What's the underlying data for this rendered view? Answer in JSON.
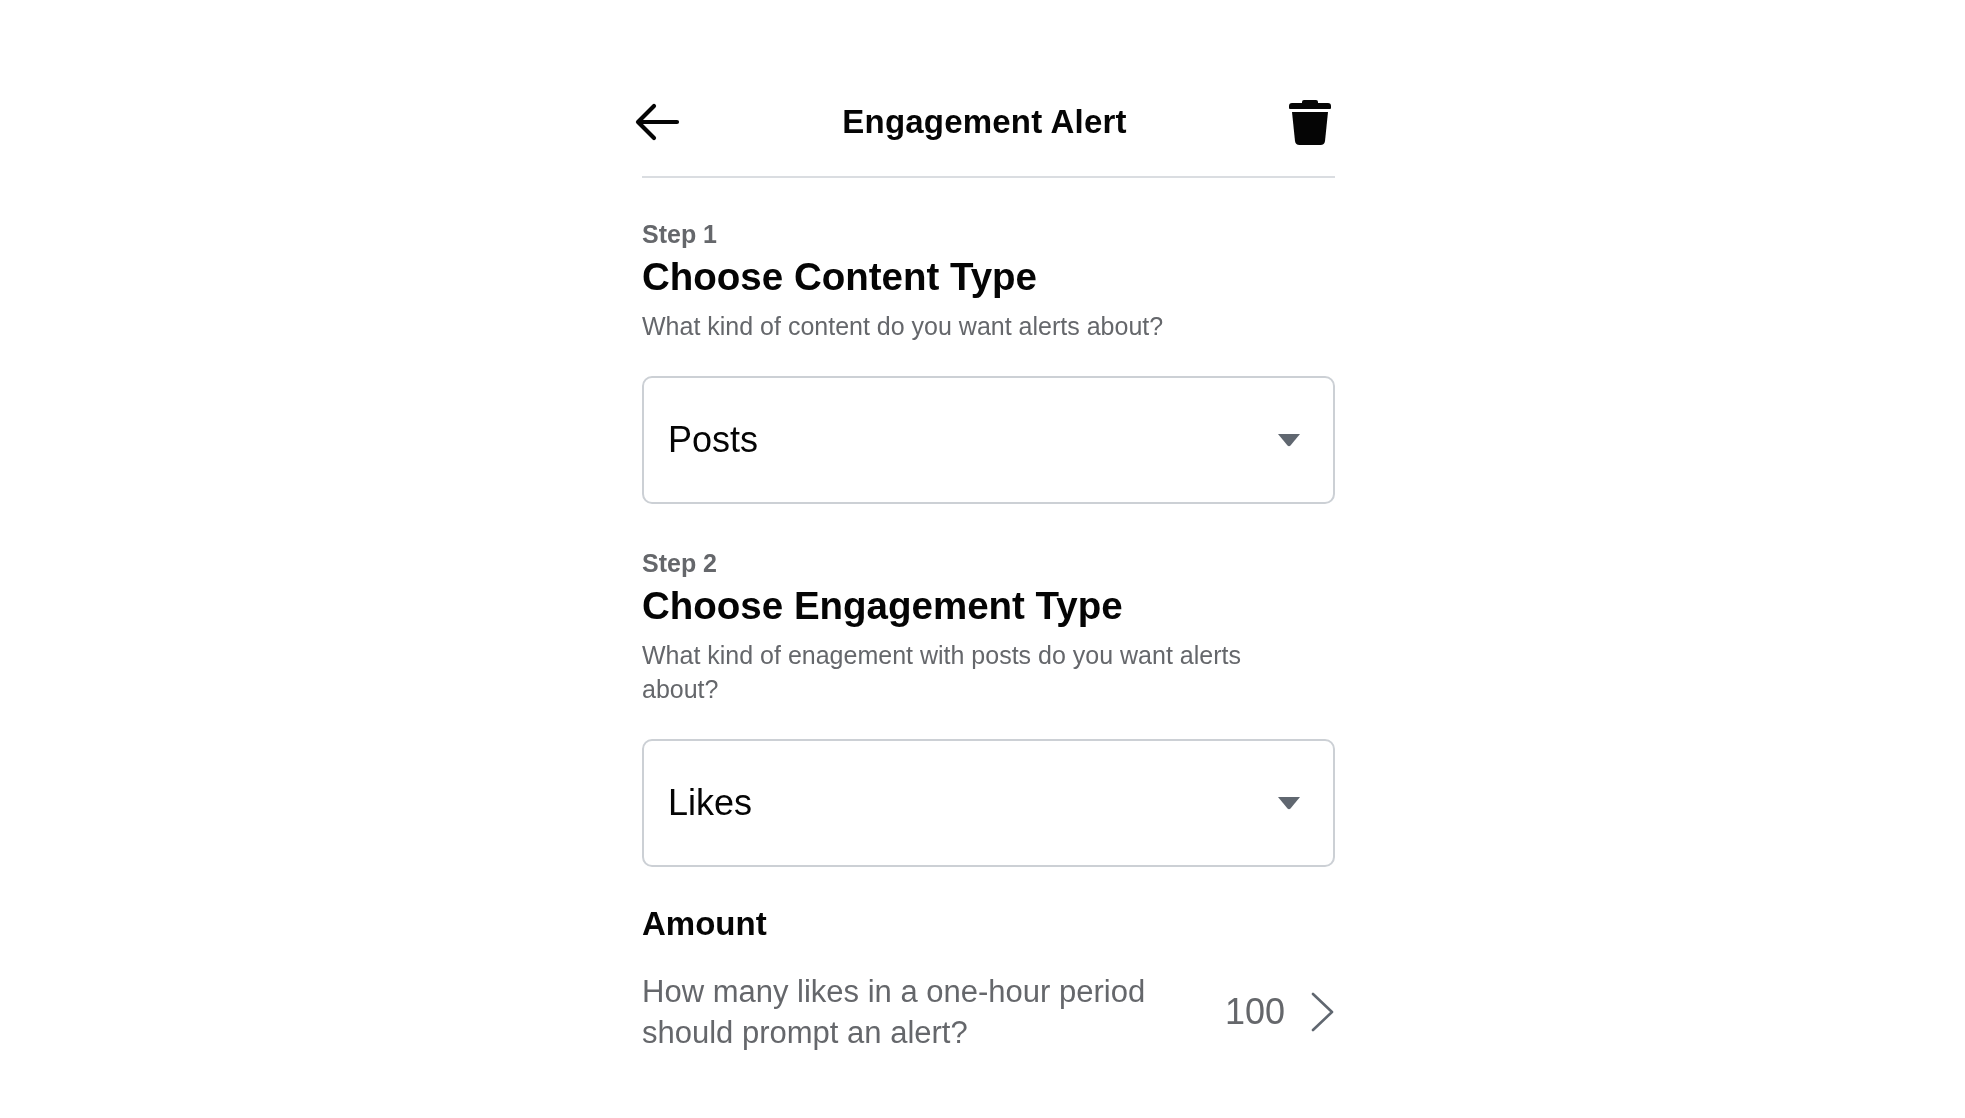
{
  "header": {
    "title": "Engagement Alert"
  },
  "steps": [
    {
      "step": "Step 1",
      "title": "Choose Content Type",
      "description": "What kind of content do you want alerts about?",
      "select": {
        "value": "Posts"
      }
    },
    {
      "step": "Step 2",
      "title": "Choose Engagement Type",
      "description": "What kind of enagement with posts do you want alerts about?",
      "select": {
        "value": "Likes"
      }
    }
  ],
  "amount": {
    "title": "Amount",
    "question": "How many likes in a one-hour period should prompt an alert?",
    "value": "100"
  }
}
